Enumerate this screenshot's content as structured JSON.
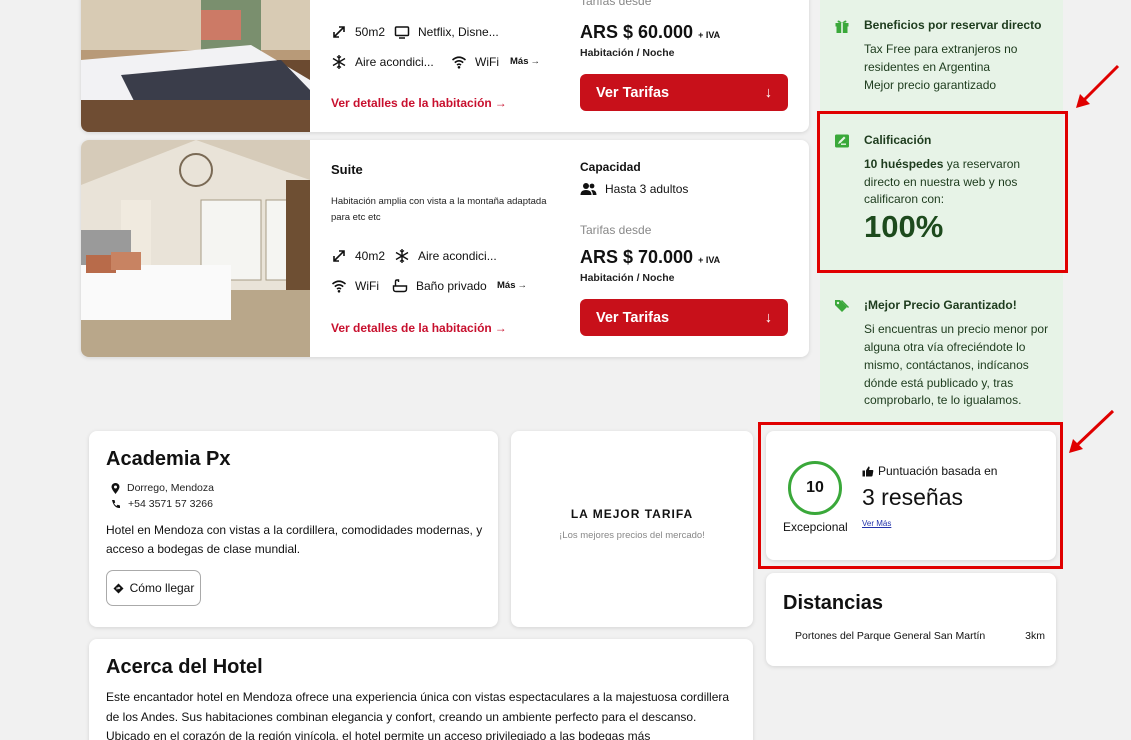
{
  "rooms": [
    {
      "name": "",
      "description": "",
      "features": [
        {
          "icon": "area-icon",
          "label": "50m2"
        },
        {
          "icon": "tv-icon",
          "label": "Netflix, Disne..."
        },
        {
          "icon": "ac-icon",
          "label": "Aire acondici..."
        },
        {
          "icon": "wifi-icon",
          "label": "WiFi"
        }
      ],
      "more_label": "Más",
      "details_label": "Ver detalles de la habitación",
      "capacity_title": "",
      "capacity_value": "",
      "from_label": "Tarifas desde",
      "price": "ARS $ 60.000",
      "iva": "+ IVA",
      "per_label": "Habitación / Noche",
      "button_label": "Ver Tarifas"
    },
    {
      "name": "Suite",
      "description": "Habitación amplia con vista a la montaña adaptada para etc etc",
      "features": [
        {
          "icon": "area-icon",
          "label": "40m2"
        },
        {
          "icon": "ac-icon",
          "label": "Aire acondici..."
        },
        {
          "icon": "wifi-icon",
          "label": "WiFi"
        },
        {
          "icon": "bath-icon",
          "label": "Baño privado"
        }
      ],
      "more_label": "Más",
      "details_label": "Ver detalles de la habitación",
      "capacity_title": "Capacidad",
      "capacity_value": "Hasta 3 adultos",
      "from_label": "Tarifas desde",
      "price": "ARS $ 70.000",
      "iva": "+ IVA",
      "per_label": "Habitación / Noche",
      "button_label": "Ver Tarifas"
    }
  ],
  "sidebar": {
    "benefits": {
      "title": "Beneficios por reservar directo",
      "lines": [
        "Tax Free para extranjeros no",
        "residentes en Argentina",
        "Mejor precio garantizado"
      ]
    },
    "rating": {
      "title": "Calificación",
      "bold": "10 huéspedes",
      "rest1": " ya reservaron",
      "line2": "directo en nuestra web y nos",
      "line3": "calificaron con:",
      "percent": "100%"
    },
    "best_price": {
      "title": "¡Mejor Precio Garantizado!",
      "lines": [
        "Si encuentras un precio menor por",
        "alguna otra vía ofreciéndote lo",
        "mismo, contáctanos, indícanos",
        "dónde está publicado y, tras",
        "comprobarlo, te lo igualamos."
      ]
    }
  },
  "hotel": {
    "name": "Academia Px",
    "address": "Dorrego, Mendoza",
    "phone": "+54 3571 57 3266",
    "description": "Hotel en Mendoza con vistas a la cordillera, comodidades modernas, y acceso a bodegas de clase mundial.",
    "directions_label": "Cómo llegar"
  },
  "best_rate": {
    "title": "LA MEJOR TARIFA",
    "subtitle": "¡Los mejores precios del mercado!"
  },
  "score": {
    "value": "10",
    "label": "Excepcional",
    "basis": "Puntuación basada en",
    "count": "3 reseñas",
    "more": "Ver Más"
  },
  "distances": {
    "title": "Distancias",
    "items": [
      {
        "place": "Portones del Parque General San Martín",
        "distance": "3km"
      }
    ]
  },
  "about": {
    "title": "Acerca del Hotel",
    "text": "Este encantador hotel en Mendoza ofrece una experiencia única con vistas espectaculares a la majestuosa cordillera de los Andes. Sus habitaciones combinan elegancia y confort, creando un ambiente perfecto para el descanso. Ubicado en el corazón de la región vinícola, el hotel permite un acceso privilegiado a las bodegas más"
  },
  "colors": {
    "accent": "#c8101a",
    "highlight": "#e00000",
    "panel": "#e7f3e7",
    "score_ring": "#3aa83a"
  }
}
